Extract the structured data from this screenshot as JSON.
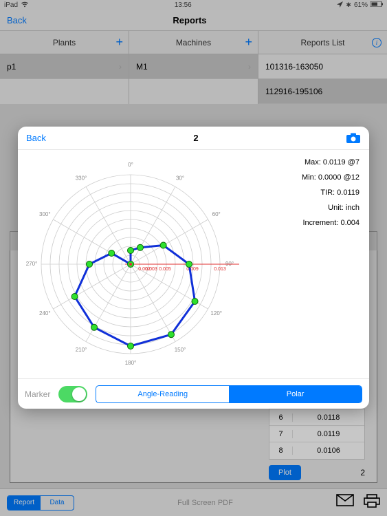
{
  "status": {
    "carrier": "iPad",
    "time": "13:56",
    "bt": "61%"
  },
  "nav": {
    "back": "Back",
    "title": "Reports"
  },
  "columns": {
    "plants": {
      "label": "Plants"
    },
    "machines": {
      "label": "Machines"
    },
    "reports": {
      "label": "Reports List"
    }
  },
  "rows": {
    "plants": [
      "p1"
    ],
    "machines": [
      "M1"
    ],
    "reports": [
      "101316-163050",
      "112916-195106"
    ]
  },
  "modal": {
    "back": "Back",
    "title": "2",
    "stats": {
      "max": "Max: 0.0119 @7",
      "min": "Min: 0.0000 @12",
      "tir": "TIR: 0.0119",
      "unit": "Unit: inch",
      "increment": "Increment: 0.004"
    },
    "marker_label": "Marker",
    "seg": {
      "angle": "Angle-Reading",
      "polar": "Polar",
      "active": "polar"
    }
  },
  "under": {
    "rows": [
      {
        "idx": "6",
        "val": "0.0118"
      },
      {
        "idx": "7",
        "val": "0.0119"
      },
      {
        "idx": "8",
        "val": "0.0106"
      }
    ],
    "plot": "Plot",
    "num": "2"
  },
  "tabs": {
    "report": "Report",
    "data": "Data",
    "fullscreen": "Full Screen PDF"
  },
  "chart_data": {
    "type": "polar",
    "angle_labels_deg": [
      0,
      30,
      60,
      90,
      120,
      150,
      180,
      210,
      240,
      270,
      300,
      330
    ],
    "radial_ticks": [
      0.002,
      0.003,
      0.005,
      0.009,
      0.013
    ],
    "points": [
      {
        "idx": 1,
        "angle_deg": 0,
        "r": 0.002
      },
      {
        "idx": 2,
        "angle_deg": 30,
        "r": 0.0028
      },
      {
        "idx": 3,
        "angle_deg": 60,
        "r": 0.0055
      },
      {
        "idx": 4,
        "angle_deg": 90,
        "r": 0.0085
      },
      {
        "idx": 5,
        "angle_deg": 120,
        "r": 0.0108
      },
      {
        "idx": 6,
        "angle_deg": 150,
        "r": 0.0118
      },
      {
        "idx": 7,
        "angle_deg": 180,
        "r": 0.0119
      },
      {
        "idx": 8,
        "angle_deg": 210,
        "r": 0.0106
      },
      {
        "idx": 9,
        "angle_deg": 240,
        "r": 0.0094
      },
      {
        "idx": 10,
        "angle_deg": 270,
        "r": 0.006
      },
      {
        "idx": 11,
        "angle_deg": 300,
        "r": 0.0032
      },
      {
        "idx": 12,
        "angle_deg": 330,
        "r": 0.0
      }
    ],
    "line_color": "#1030d8",
    "marker_color": "#2ee02e",
    "r_max": 0.013,
    "title": ""
  }
}
